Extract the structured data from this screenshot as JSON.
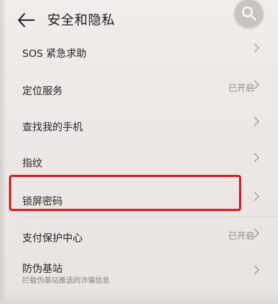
{
  "header": {
    "title": "安全和隐私",
    "back_icon": "arrow-left-icon",
    "search_icon": "search-icon"
  },
  "items": [
    {
      "label": "SOS 紧急求助",
      "value": "",
      "sub": ""
    },
    {
      "label": "定位服务",
      "value": "已开启",
      "sub": ""
    },
    {
      "label": "查找我的手机",
      "value": "",
      "sub": ""
    },
    {
      "label": "指纹",
      "value": "",
      "sub": ""
    },
    {
      "label": "锁屏密码",
      "value": "",
      "sub": ""
    },
    {
      "label": "支付保护中心",
      "value": "已开启",
      "sub": ""
    },
    {
      "label": "防伪基站",
      "value": "",
      "sub": "拦截伪基站推送的诈骗信息"
    }
  ],
  "colors": {
    "highlight": "#e8121a",
    "background": "#ece8e6"
  }
}
